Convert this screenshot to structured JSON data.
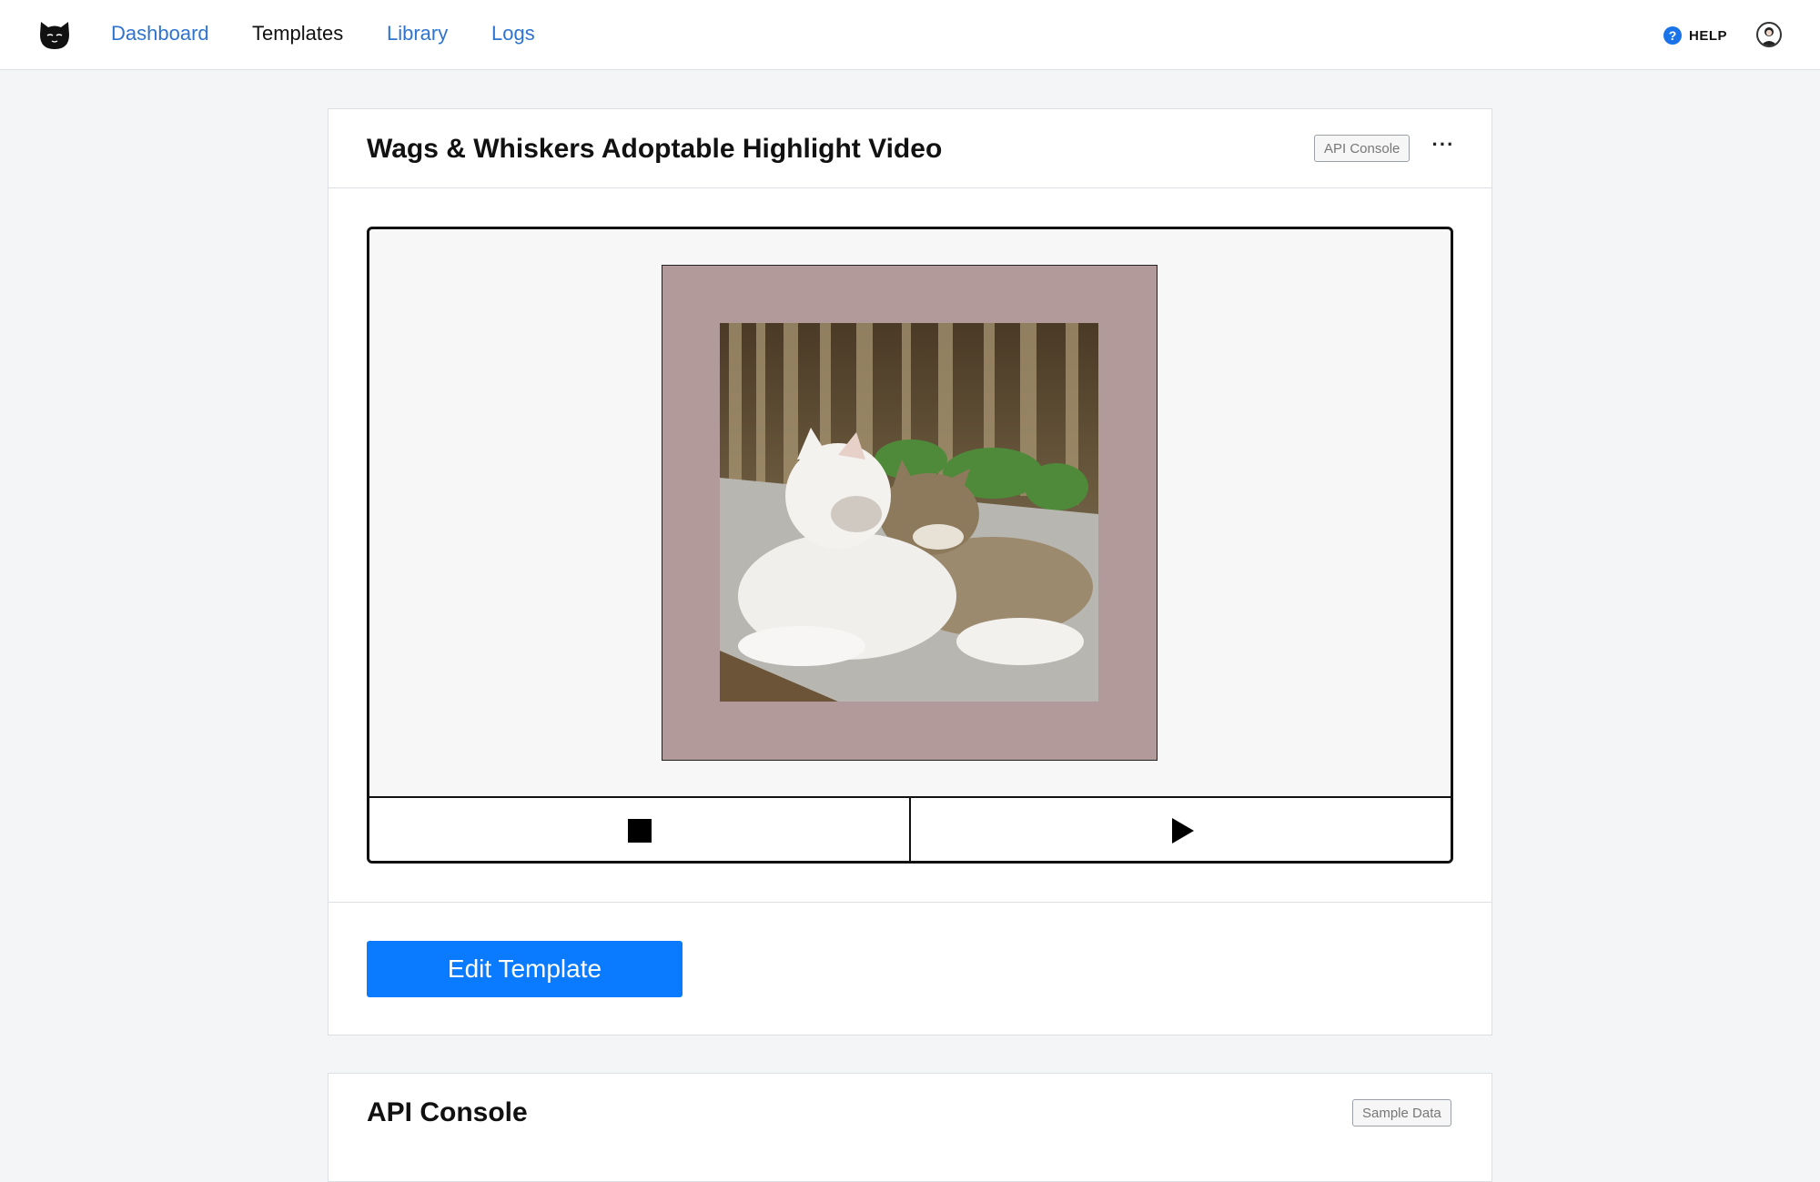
{
  "nav": {
    "links": [
      {
        "label": "Dashboard"
      },
      {
        "label": "Templates"
      },
      {
        "label": "Library"
      },
      {
        "label": "Logs"
      }
    ],
    "active": "Templates",
    "help_label": "HELP",
    "logo_icon": "cat-logo-icon",
    "link_color": "#2f74d0"
  },
  "template_card": {
    "title": "Wags & Whiskers Adoptable Highlight Video",
    "api_console_label": "API Console",
    "more_icon": "ellipsis-icon",
    "preview": {
      "frame_color": "#b29a9a",
      "image_subject": "two cats resting together on a wooden bench"
    },
    "controls": {
      "stop_icon": "stop-icon",
      "play_icon": "play-icon"
    },
    "edit_label": "Edit Template",
    "edit_color": "#0a7bff"
  },
  "api_card": {
    "title": "API Console",
    "sample_data_label": "Sample Data"
  }
}
